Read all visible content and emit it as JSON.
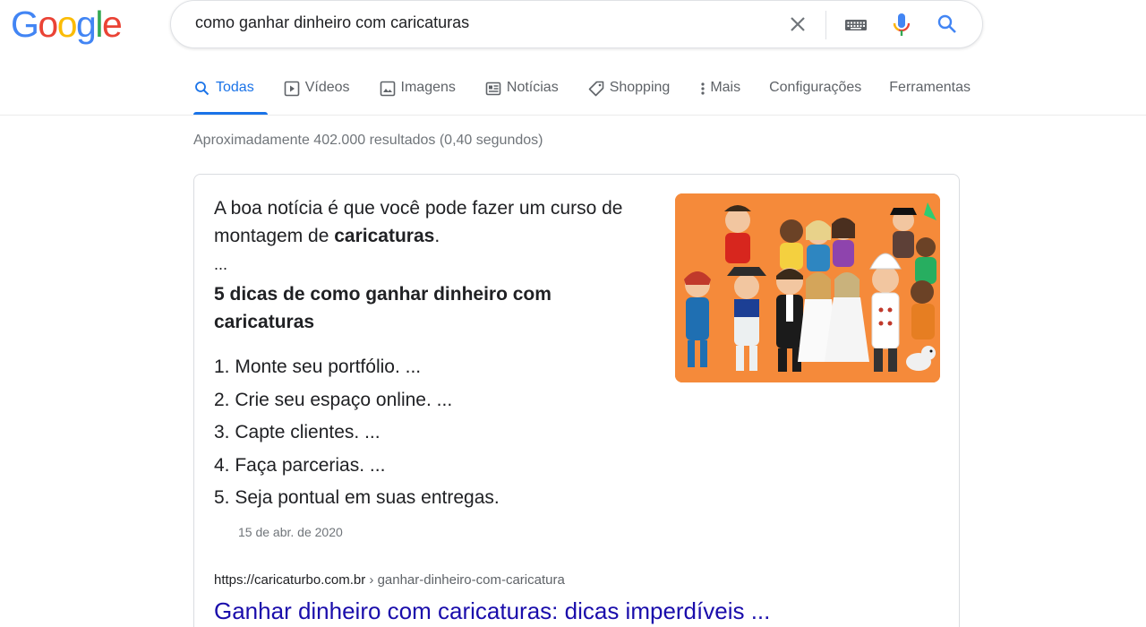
{
  "logo": {
    "letters": [
      "G",
      "o",
      "o",
      "g",
      "l",
      "e"
    ],
    "colors": [
      "#4285f4",
      "#ea4335",
      "#fbbc05",
      "#4285f4",
      "#34a853",
      "#ea4335"
    ]
  },
  "search": {
    "query": "como ganhar dinheiro com caricaturas"
  },
  "icons": {
    "clear": "close-icon",
    "keyboard": "keyboard-icon",
    "mic": "mic-icon",
    "search": "search-icon"
  },
  "tabs": [
    {
      "label": "Todas",
      "icon": "search-icon",
      "active": true
    },
    {
      "label": "Vídeos",
      "icon": "play-icon"
    },
    {
      "label": "Imagens",
      "icon": "image-icon"
    },
    {
      "label": "Notícias",
      "icon": "news-icon"
    },
    {
      "label": "Shopping",
      "icon": "tag-icon"
    },
    {
      "label": "Mais",
      "icon": "more-vert-icon"
    },
    {
      "label": "Configurações"
    },
    {
      "label": "Ferramentas"
    }
  ],
  "stats": "Aproximadamente 402.000 resultados (0,40 segundos)",
  "snippet": {
    "text_before": "A boa notícia é que você pode fazer um curso de montagem de ",
    "text_bold": "caricaturas",
    "text_after": ".",
    "ellipsis": "...",
    "heading": "5 dicas de como ganhar dinheiro com caricaturas",
    "steps": [
      "1. Monte seu portfólio. ...",
      "2. Crie seu espaço online. ...",
      "3. Capte clientes. ...",
      "4. Faça parcerias. ...",
      "5. Seja pontual em suas entregas."
    ],
    "date": "15 de abr. de 2020"
  },
  "result": {
    "url_domain": "https://caricaturbo.com.br",
    "url_path": " › ganhar-dinheiro-com-caricatura",
    "title": "Ganhar dinheiro com caricaturas: dicas imperdíveis ..."
  },
  "colors": {
    "accent": "#1a73e8",
    "link": "#1a0dab",
    "muted": "#70757a",
    "thumb_bg": "#f58a3a"
  }
}
